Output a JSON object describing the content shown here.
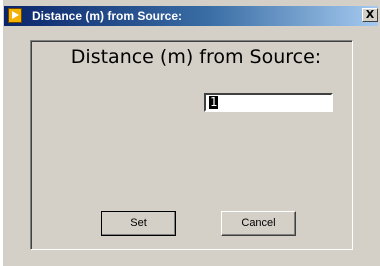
{
  "window": {
    "title": "Distance (m) from Source:",
    "close_label": "X"
  },
  "dialog": {
    "heading": "Distance (m) from Source:",
    "input_value": "1"
  },
  "buttons": {
    "set_label": "Set",
    "cancel_label": "Cancel"
  },
  "icons": {
    "app_icon": "labview-run-arrow-icon",
    "close_icon": "close-icon"
  },
  "colors": {
    "titlebar_start": "#0a246a",
    "titlebar_end": "#a6caf0",
    "window_bg": "#d4d0c8",
    "app_icon": "#f5b000"
  }
}
